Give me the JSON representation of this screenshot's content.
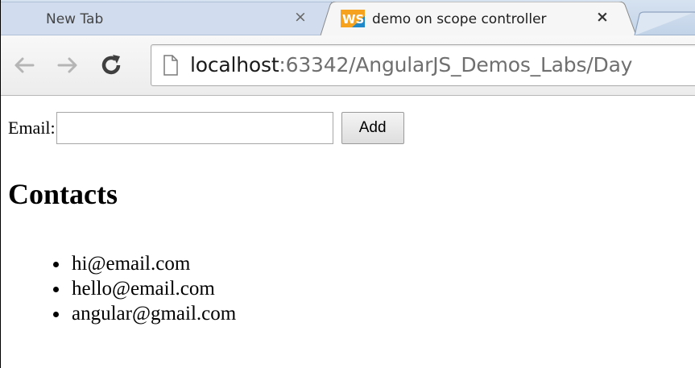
{
  "browser": {
    "tabs": [
      {
        "label": "New Tab",
        "close": "×"
      },
      {
        "label": "demo on scope controller",
        "close": "×"
      }
    ],
    "url_host": "localhost",
    "url_rest": ":63342/AngularJS_Demos_Labs/Day"
  },
  "icons": {
    "back": "back-arrow-icon",
    "forward": "forward-arrow-icon",
    "reload": "reload-icon",
    "page": "page-icon",
    "tab_favicon": "webstorm-icon"
  },
  "form": {
    "email_label": "Email:",
    "email_value": "",
    "add_label": "Add"
  },
  "contacts": {
    "title": "Contacts",
    "items": [
      "hi@email.com",
      "hello@email.com",
      "angular@gmail.com"
    ]
  },
  "colors": {
    "tab_strip": "#c9d8ec",
    "active_tab": "#f5f5f5",
    "url_host": "#1a1a1a",
    "url_path": "#6f6f6f"
  }
}
